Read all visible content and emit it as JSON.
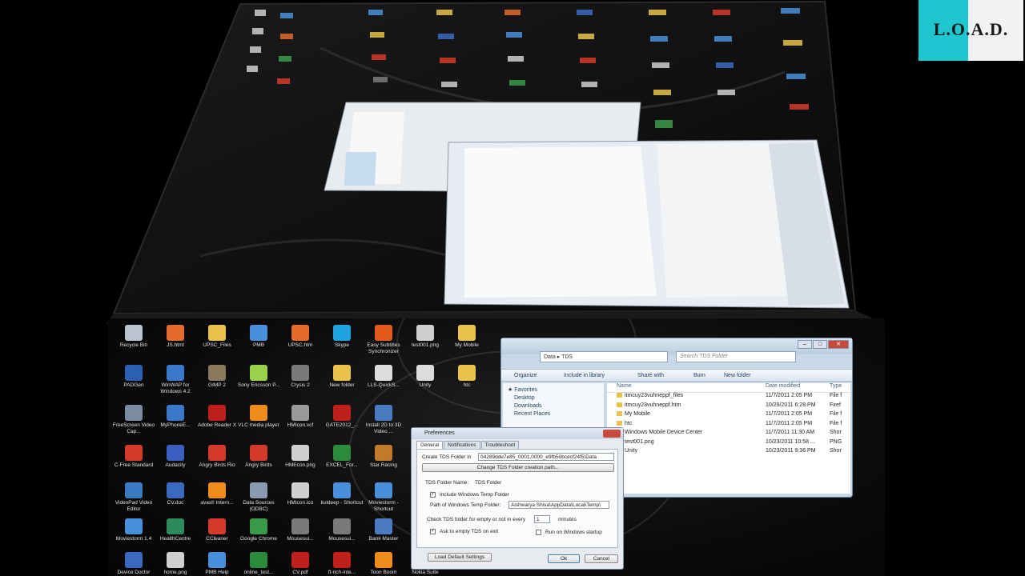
{
  "logo": {
    "text": "L.O.A.D."
  },
  "desktop_icons": [
    {
      "label": "Recycle Bin",
      "color": "#b9c4cf"
    },
    {
      "label": "JS.html",
      "color": "#e36b2b"
    },
    {
      "label": "UPSC_Files",
      "color": "#e8c24a"
    },
    {
      "label": "PMB",
      "color": "#4a8fd9"
    },
    {
      "label": "UPSC.htm",
      "color": "#e36b2b"
    },
    {
      "label": "Skype",
      "color": "#1fa3e0"
    },
    {
      "label": "Easy Subtitles Synchronizer",
      "color": "#e35a1c"
    },
    {
      "label": "test001.png",
      "color": "#cfcfcf"
    },
    {
      "label": "My Mobile",
      "color": "#e8c24a"
    },
    {
      "label": "PADGen",
      "color": "#2b5fb3"
    },
    {
      "label": "WinWAP for Windows 4.2",
      "color": "#3b78c9"
    },
    {
      "label": "GIMP 2",
      "color": "#8a7a5c"
    },
    {
      "label": "Sony Ericsson P...",
      "color": "#9bd04a"
    },
    {
      "label": "Crysis 2",
      "color": "#7a7a7a"
    },
    {
      "label": "New folder",
      "color": "#e8c24a"
    },
    {
      "label": "LLS-QuickS...",
      "color": "#dcdcdc"
    },
    {
      "label": "Unity",
      "color": "#dcdcdc"
    },
    {
      "label": "htc",
      "color": "#e8c24a"
    },
    {
      "label": "FreeScreen Video Cap...",
      "color": "#7a8da0"
    },
    {
      "label": "MyPhoneE...",
      "color": "#3b78c9"
    },
    {
      "label": "Adobe Reader X",
      "color": "#c0201c"
    },
    {
      "label": "VLC media player",
      "color": "#f08c1c"
    },
    {
      "label": "HMIcon.xcf",
      "color": "#9a9a9a"
    },
    {
      "label": "GATE2012_...",
      "color": "#c0201c"
    },
    {
      "label": "Install 2D to 3D Video ...",
      "color": "#4a7ac0"
    },
    {
      "label": "C-Free Standard",
      "color": "#d43a2a"
    },
    {
      "label": "Audacity",
      "color": "#3a5fc0"
    },
    {
      "label": "Angry Birds Rio",
      "color": "#d43a2a"
    },
    {
      "label": "Angry Birds",
      "color": "#d43a2a"
    },
    {
      "label": "HMEcon.png",
      "color": "#cfcfcf"
    },
    {
      "label": "EXCEL_For...",
      "color": "#2c8a3c"
    },
    {
      "label": "Star Racing",
      "color": "#c07a2a"
    },
    {
      "label": "VideoPad Video Editor",
      "color": "#3a7ac0"
    },
    {
      "label": "CV.doc",
      "color": "#3a6ac0"
    },
    {
      "label": "avast! Intern...",
      "color": "#f08c1c"
    },
    {
      "label": "Data Sources (ODBC)",
      "color": "#8a9ab0"
    },
    {
      "label": "HMIcon.ico",
      "color": "#cfcfcf"
    },
    {
      "label": "kuldeep - Shortcut",
      "color": "#4a8fd9"
    },
    {
      "label": "Moviestorm - Shortcut",
      "color": "#4a8fd9"
    },
    {
      "label": "Moviestorm 1.4",
      "color": "#4a8fd9"
    },
    {
      "label": "HealthCentre",
      "color": "#2c8a5c"
    },
    {
      "label": "CCleaner",
      "color": "#d43a2a"
    },
    {
      "label": "Google Chrome",
      "color": "#3a9a4a"
    },
    {
      "label": "Mousesui...",
      "color": "#7a7a7a"
    },
    {
      "label": "Mousesui...",
      "color": "#7a7a7a"
    },
    {
      "label": "Bank Master",
      "color": "#4a7ac0"
    },
    {
      "label": "Device Doctor",
      "color": "#3a6ac0"
    },
    {
      "label": "home.png",
      "color": "#cfcfcf"
    },
    {
      "label": "PMB Help",
      "color": "#4a8fd9"
    },
    {
      "label": "online_test...",
      "color": "#2c8a3c"
    },
    {
      "label": "CV.pdf",
      "color": "#c0201c"
    },
    {
      "label": "ft-rich-inte...",
      "color": "#c0201c"
    },
    {
      "label": "Toon Boom",
      "color": "#f08c1c"
    },
    {
      "label": "Nokia Suite",
      "color": "#3a6ac0"
    }
  ],
  "explorer": {
    "address": "Data ▸ TDS",
    "search_placeholder": "Search TDS Folder",
    "toolbar": [
      "Organize",
      "Include in library",
      "Share with",
      "Burn",
      "New folder"
    ],
    "nav": [
      "Favorites",
      "Desktop",
      "Downloads",
      "Recent Places"
    ],
    "headers": [
      "Name",
      "Date modified",
      "Type"
    ],
    "files": [
      {
        "name": "itmcuy23vuhneppf_files",
        "date": "11/7/2011 2:05 PM",
        "type": "File f"
      },
      {
        "name": "itmcuy23vuhneppf.htm",
        "date": "10/29/2011 6:28 PM",
        "type": "Firef"
      },
      {
        "name": "My Mobile",
        "date": "11/7/2011 2:05 PM",
        "type": "File f"
      },
      {
        "name": "htc",
        "date": "11/7/2011 2:05 PM",
        "type": "File f"
      },
      {
        "name": "Windows Mobile Device Center",
        "date": "11/7/2011 11:30 AM",
        "type": "Shor"
      },
      {
        "name": "test001.png",
        "date": "10/23/2011 10:58 ...",
        "type": "PNG"
      },
      {
        "name": "Unity",
        "date": "10/23/2011 9:36 PM",
        "type": "Shor"
      }
    ]
  },
  "prefs": {
    "title": "Preferences",
    "tabs": [
      "General",
      "Notifications",
      "Troubleshoot"
    ],
    "create_label": "Create TDS Folder in",
    "create_value": "04289dde7e85_0001.0000_e9fb50bcecf24f5\\Data",
    "change_btn": "Change TDS Folder creation path...",
    "folder_name_label": "TDS Folder Name:",
    "folder_name_value": "TDS Folder",
    "include_temp": "Include Windows Temp Folder",
    "temp_path_label": "Path of Windows Temp Folder:",
    "temp_path_value": "Aishwarya Shiva\\AppData\\Local\\Temp\\",
    "check_label": "Check TDS folder for empty or not in every",
    "check_value": "1",
    "minutes": "minutes",
    "ask_empty": "Ask to empty TDS on exit",
    "run_startup": "Run on Windows startup",
    "load_default": "Load Default Settings",
    "ok": "Ok",
    "cancel": "Cancel"
  }
}
